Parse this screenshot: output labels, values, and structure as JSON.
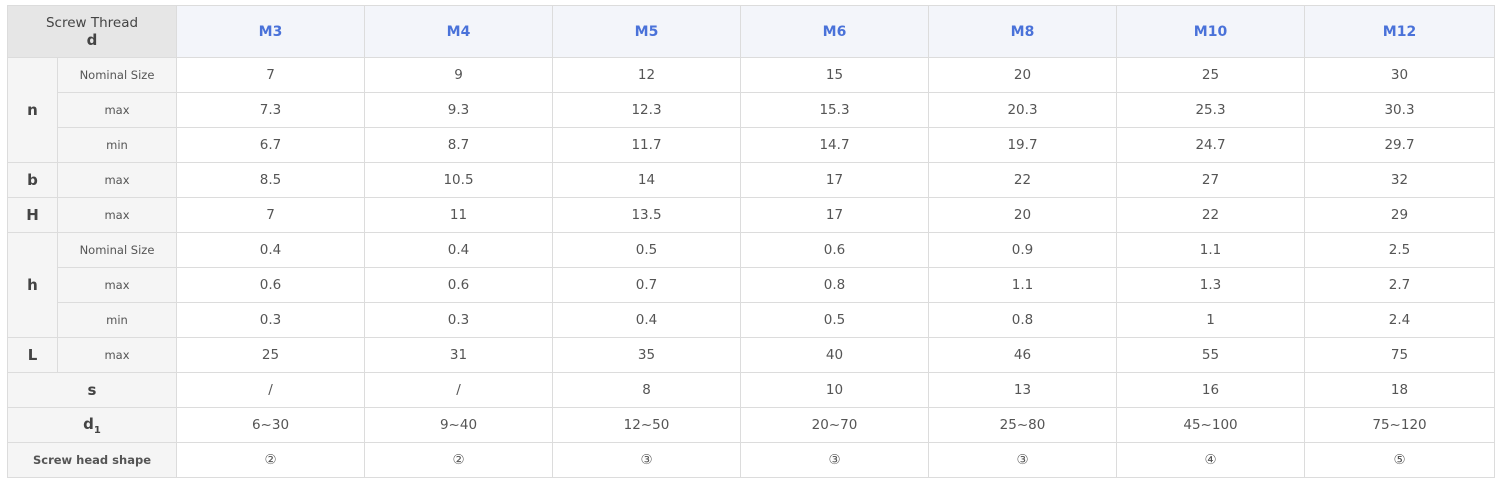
{
  "header": {
    "corner_line1": "Screw Thread",
    "corner_line2": "d",
    "columns": [
      "M3",
      "M4",
      "M5",
      "M6",
      "M8",
      "M10",
      "M12"
    ]
  },
  "sections": {
    "n": {
      "symbol": "n",
      "rows": [
        {
          "label": "Nominal Size",
          "values": [
            "7",
            "9",
            "12",
            "15",
            "20",
            "25",
            "30"
          ]
        },
        {
          "label": "max",
          "values": [
            "7.3",
            "9.3",
            "12.3",
            "15.3",
            "20.3",
            "25.3",
            "30.3"
          ]
        },
        {
          "label": "min",
          "values": [
            "6.7",
            "8.7",
            "11.7",
            "14.7",
            "19.7",
            "24.7",
            "29.7"
          ]
        }
      ]
    },
    "b": {
      "symbol": "b",
      "rows": [
        {
          "label": "max",
          "values": [
            "8.5",
            "10.5",
            "14",
            "17",
            "22",
            "27",
            "32"
          ]
        }
      ]
    },
    "H": {
      "symbol": "H",
      "rows": [
        {
          "label": "max",
          "values": [
            "7",
            "11",
            "13.5",
            "17",
            "20",
            "22",
            "29"
          ]
        }
      ]
    },
    "h": {
      "symbol": "h",
      "rows": [
        {
          "label": "Nominal Size",
          "values": [
            "0.4",
            "0.4",
            "0.5",
            "0.6",
            "0.9",
            "1.1",
            "2.5"
          ]
        },
        {
          "label": "max",
          "values": [
            "0.6",
            "0.6",
            "0.7",
            "0.8",
            "1.1",
            "1.3",
            "2.7"
          ]
        },
        {
          "label": "min",
          "values": [
            "0.3",
            "0.3",
            "0.4",
            "0.5",
            "0.8",
            "1",
            "2.4"
          ]
        }
      ]
    },
    "L": {
      "symbol": "L",
      "rows": [
        {
          "label": "max",
          "values": [
            "25",
            "31",
            "35",
            "40",
            "46",
            "55",
            "75"
          ]
        }
      ]
    },
    "s": {
      "symbol": "s",
      "values": [
        "/",
        "/",
        "8",
        "10",
        "13",
        "16",
        "18"
      ]
    },
    "d1": {
      "symbol": "d",
      "subscript": "1",
      "values": [
        "6~30",
        "9~40",
        "12~50",
        "20~70",
        "25~80",
        "45~100",
        "75~120"
      ]
    },
    "shape": {
      "label": "Screw head shape",
      "values": [
        "②",
        "②",
        "③",
        "③",
        "③",
        "④",
        "⑤"
      ]
    }
  },
  "colors": {
    "header_text": "#4a72d9",
    "header_bg": "#f3f5fa",
    "corner_bg": "#e6e6e6",
    "label_bg": "#f5f5f5",
    "border": "#dcdcdc"
  }
}
